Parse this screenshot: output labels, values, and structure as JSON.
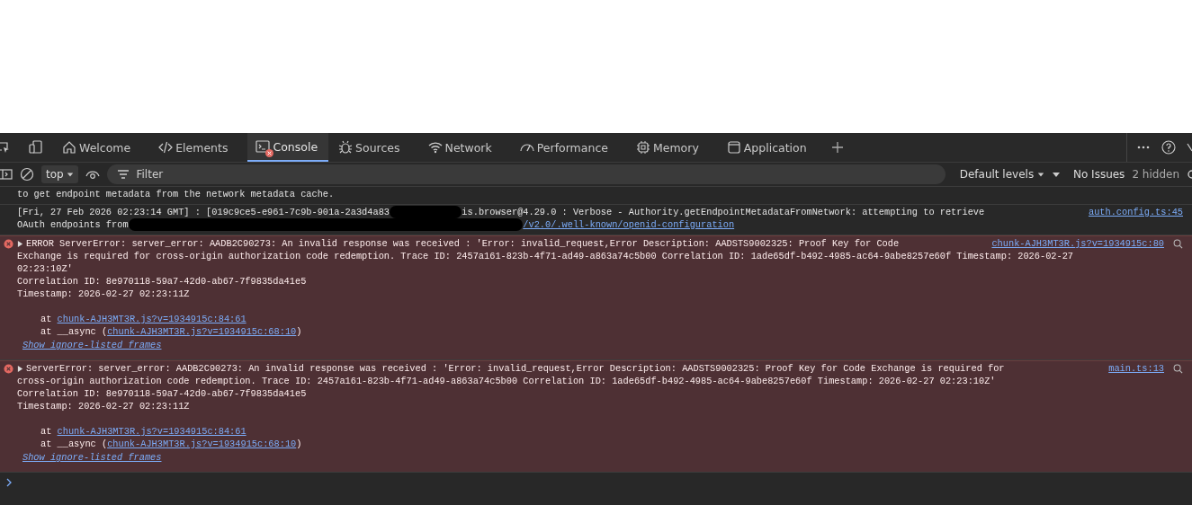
{
  "tabs": [
    {
      "label": "Welcome",
      "selected": false,
      "badge": false
    },
    {
      "label": "Elements",
      "selected": false,
      "badge": false
    },
    {
      "label": "Console",
      "selected": true,
      "badge": true
    },
    {
      "label": "Sources",
      "selected": false,
      "badge": false
    },
    {
      "label": "Network",
      "selected": false,
      "badge": false
    },
    {
      "label": "Performance",
      "selected": false,
      "badge": false
    },
    {
      "label": "Memory",
      "selected": false,
      "badge": false
    },
    {
      "label": "Application",
      "selected": false,
      "badge": false
    }
  ],
  "toolbar": {
    "context": "top",
    "filter": {
      "placeholder": "Filter"
    },
    "levels": "Default levels",
    "issues": "No Issues",
    "hidden": "2 hidden"
  },
  "messages": [
    {
      "kind": "verbose",
      "lines": [
        [
          {
            "kind": "text",
            "text": "to get endpoint metadata from the network metadata cache."
          }
        ]
      ]
    },
    {
      "kind": "verbose",
      "source": "auth.config.ts:45",
      "lines": [
        [
          {
            "kind": "text",
            "text": "[Fri, 27 Feb 2026 02:23:14 GMT] : [019c9ce5-e961-7c9b-901a-2a3d4a83"
          },
          {
            "kind": "redacted"
          },
          {
            "kind": "text",
            "text": "is.browser@4.29.0 : Verbose - Authority.getEndpointMetadataFromNetwork: attempting to retrieve"
          }
        ],
        [
          {
            "kind": "text",
            "text": "OAuth endpoints from"
          },
          {
            "kind": "redacted"
          },
          {
            "kind": "link",
            "text": "/v2.0/.well-known/openid-configuration"
          }
        ]
      ]
    },
    {
      "kind": "error",
      "expanded": false,
      "source": "chunk-AJH3MT3R.js?v=1934915c:80",
      "lines": [
        [
          {
            "kind": "text",
            "text": "ERROR ServerError: server_error: AADB2C90273: An invalid response was received : 'Error: invalid_request,Error Description: AADSTS9002325: Proof Key for Code"
          }
        ],
        [
          {
            "kind": "text",
            "text": "Exchange is required for cross-origin authorization code redemption. Trace ID: 2457a161-823b-4f71-ad49-a863a74c5b00 Correlation ID: 1ade65df-b492-4985-ac64-9abe8257e60f Timestamp: 2026-02-27"
          }
        ],
        [
          {
            "kind": "text",
            "text": "02:23:10Z'"
          }
        ],
        [
          {
            "kind": "text",
            "text": "Correlation ID: 8e970118-59a7-42d0-ab67-7f9835da41e5"
          }
        ],
        [
          {
            "kind": "text",
            "text": "Timestamp: 2026-02-27 02:23:11Z"
          }
        ]
      ],
      "stack": [
        {
          "prefix": "at ",
          "link": "chunk-AJH3MT3R.js?v=1934915c:84:61"
        },
        {
          "prefix": "at __async (",
          "link": "chunk-AJH3MT3R.js?v=1934915c:68:10",
          "suffix": ")"
        }
      ],
      "show_frames": "Show ignore-listed frames"
    },
    {
      "kind": "error",
      "expanded": false,
      "source": "main.ts:13",
      "lines": [
        [
          {
            "kind": "text",
            "text": "ServerError: server_error: AADB2C90273: An invalid response was received : 'Error: invalid_request,Error Description: AADSTS9002325: Proof Key for Code Exchange is required for"
          }
        ],
        [
          {
            "kind": "text",
            "text": "cross-origin authorization code redemption. Trace ID: 2457a161-823b-4f71-ad49-a863a74c5b00 Correlation ID: 1ade65df-b492-4985-ac64-9abe8257e60f Timestamp: 2026-02-27 02:23:10Z'"
          }
        ],
        [
          {
            "kind": "text",
            "text": "Correlation ID: 8e970118-59a7-42d0-ab67-7f9835da41e5"
          }
        ],
        [
          {
            "kind": "text",
            "text": "Timestamp: 2026-02-27 02:23:11Z"
          }
        ]
      ],
      "stack": [
        {
          "prefix": "at ",
          "link": "chunk-AJH3MT3R.js?v=1934915c:84:61"
        },
        {
          "prefix": "at __async (",
          "link": "chunk-AJH3MT3R.js?v=1934915c:68:10",
          "suffix": ")"
        }
      ],
      "show_frames": "Show ignore-listed frames"
    }
  ]
}
